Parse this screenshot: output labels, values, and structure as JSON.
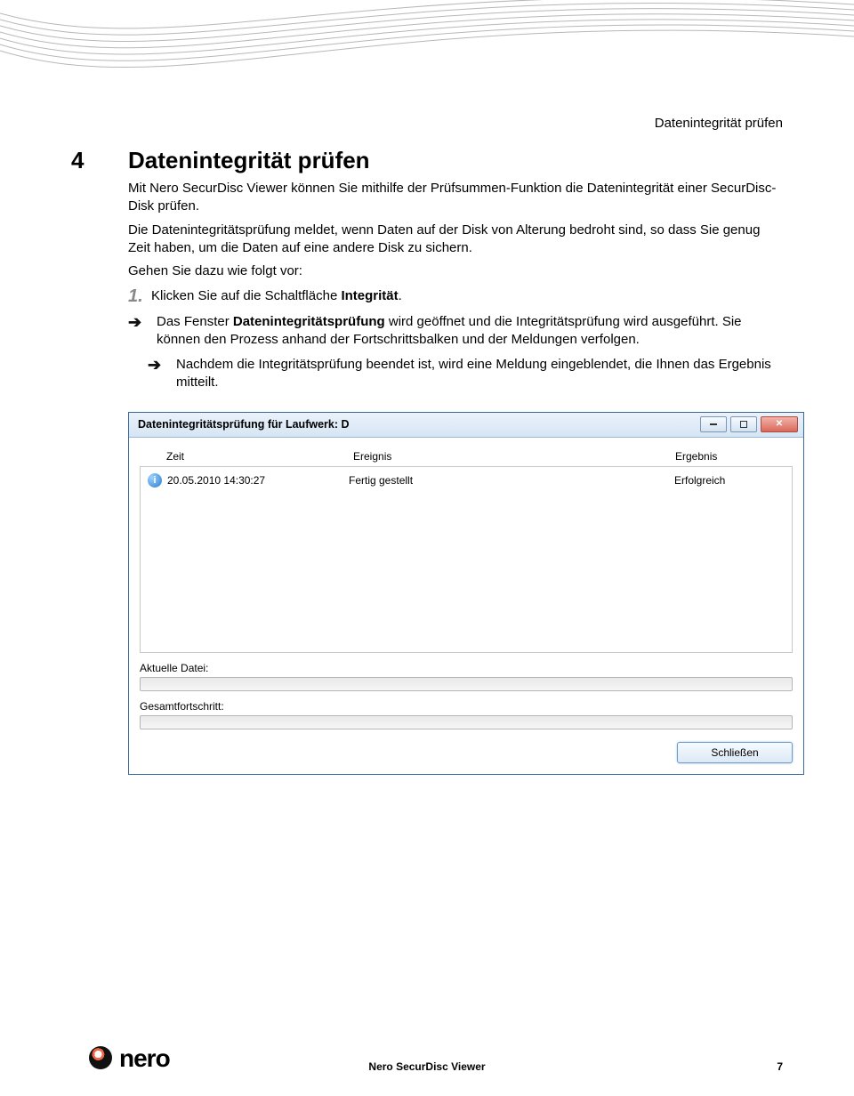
{
  "header_context": "Datenintegrität prüfen",
  "section": {
    "number": "4",
    "title": "Datenintegrität prüfen"
  },
  "paragraphs": {
    "p1": "Mit Nero SecurDisc Viewer können Sie mithilfe der Prüfsummen-Funktion die Datenintegrität einer SecurDisc-Disk prüfen.",
    "p2": "Die Datenintegritätsprüfung meldet, wenn Daten auf der Disk von Alterung bedroht sind, so dass Sie genug Zeit haben, um die Daten auf eine andere Disk zu sichern.",
    "p3": "Gehen Sie dazu wie folgt vor:"
  },
  "step1": {
    "num": "1.",
    "pre": "Klicken Sie auf die Schaltfläche ",
    "bold": "Integrität",
    "post": "."
  },
  "result1": {
    "pre": "Das Fenster ",
    "bold": "Datenintegritätsprüfung",
    "post": " wird geöffnet und die Integritätsprüfung wird ausgeführt. Sie können den Prozess anhand der Fortschrittsbalken und der Meldungen verfolgen."
  },
  "result2": "Nachdem die Integritätsprüfung beendet ist, wird eine Meldung eingeblendet, die Ihnen das Ergebnis mitteilt.",
  "window": {
    "title": "Datenintegritätsprüfung für Laufwerk: D",
    "columns": {
      "time": "Zeit",
      "event": "Ereignis",
      "result": "Ergebnis"
    },
    "row": {
      "time": "20.05.2010 14:30:27",
      "event": "Fertig gestellt",
      "result": "Erfolgreich"
    },
    "current_file_label": "Aktuelle Datei:",
    "overall_label": "Gesamtfortschritt:",
    "close_button": "Schließen"
  },
  "footer": {
    "logo_text": "nero",
    "center": "Nero SecurDisc Viewer",
    "page": "7"
  }
}
